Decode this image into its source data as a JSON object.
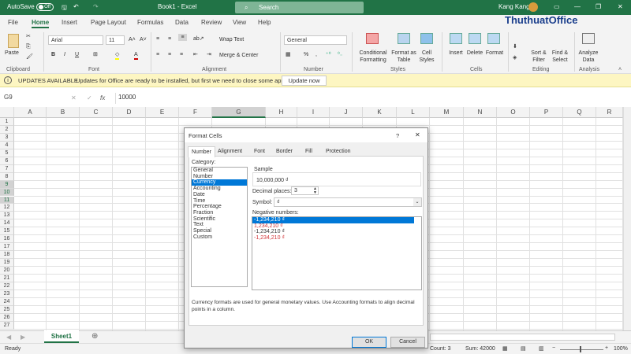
{
  "titlebar": {
    "autosave": "AutoSave",
    "autosave_state": "Off",
    "title": "Book1 - Excel",
    "search": "Search",
    "user": "Kang Kang",
    "watermark": "ThuthuatOffice"
  },
  "tabs": [
    "File",
    "Home",
    "Insert",
    "Page Layout",
    "Formulas",
    "Data",
    "Review",
    "View",
    "Help"
  ],
  "ribbon": {
    "paste": "Paste",
    "font_name": "Arial",
    "font_size": "11",
    "wrap_text": "Wrap Text",
    "merge_center": "Merge & Center",
    "number_format": "General",
    "conditional": "Conditional Formatting",
    "format_table": "Format as Table",
    "cell_styles": "Cell Styles",
    "insert": "Insert",
    "delete": "Delete",
    "format": "Format",
    "sort_filter": "Sort & Filter",
    "find_select": "Find & Select",
    "analyze": "Analyze Data",
    "groups": [
      "Clipboard",
      "Font",
      "Alignment",
      "Number",
      "Styles",
      "Cells",
      "Editing",
      "Analysis"
    ]
  },
  "infobar": {
    "title": "UPDATES AVAILABLE",
    "message": "Updates for Office are ready to be installed, but first we need to close some apps.",
    "button": "Update now"
  },
  "formula": {
    "name_box": "G9",
    "value": "10000",
    "fx": "fx"
  },
  "columns": [
    "A",
    "B",
    "C",
    "D",
    "E",
    "F",
    "G",
    "H",
    "I",
    "J",
    "K",
    "L",
    "M",
    "N",
    "O",
    "P",
    "Q",
    "R"
  ],
  "row_count": 27,
  "sheet": {
    "tab": "Sheet1"
  },
  "status": {
    "ready": "Ready",
    "count": "Count: 3",
    "sum": "Sum: 42000",
    "zoom": "100%"
  },
  "dialog": {
    "title": "Format Cells",
    "help": "?",
    "tabs": [
      "Number",
      "Alignment",
      "Font",
      "Border",
      "Fill",
      "Protection"
    ],
    "active_tab": "Number",
    "category_label": "Category:",
    "categories": [
      "General",
      "Number",
      "Currency",
      "Accounting",
      "Date",
      "Time",
      "Percentage",
      "Fraction",
      "Scientific",
      "Text",
      "Special",
      "Custom"
    ],
    "selected_category": "Currency",
    "sample_label": "Sample",
    "sample_value": "10,000,000 ₫",
    "decimal_label": "Decimal places:",
    "decimal_value": "3",
    "symbol_label": "Symbol:",
    "symbol_value": "₫",
    "negative_label": "Negative numbers:",
    "negatives": [
      {
        "text": "-1,234,210 ₫",
        "red": false,
        "selected": true
      },
      {
        "text": "1,234,210 ₫",
        "red": true
      },
      {
        "text": "-1,234,210 ₫",
        "red": false
      },
      {
        "text": "-1,234,210 ₫",
        "red": true
      }
    ],
    "description": "Currency formats are used for general monetary values.  Use Accounting formats to align decimal points in a column.",
    "ok": "OK",
    "cancel": "Cancel"
  },
  "colors": {
    "brand": "#217346",
    "selection": "#0078d7",
    "negative_red": "#d13438"
  }
}
